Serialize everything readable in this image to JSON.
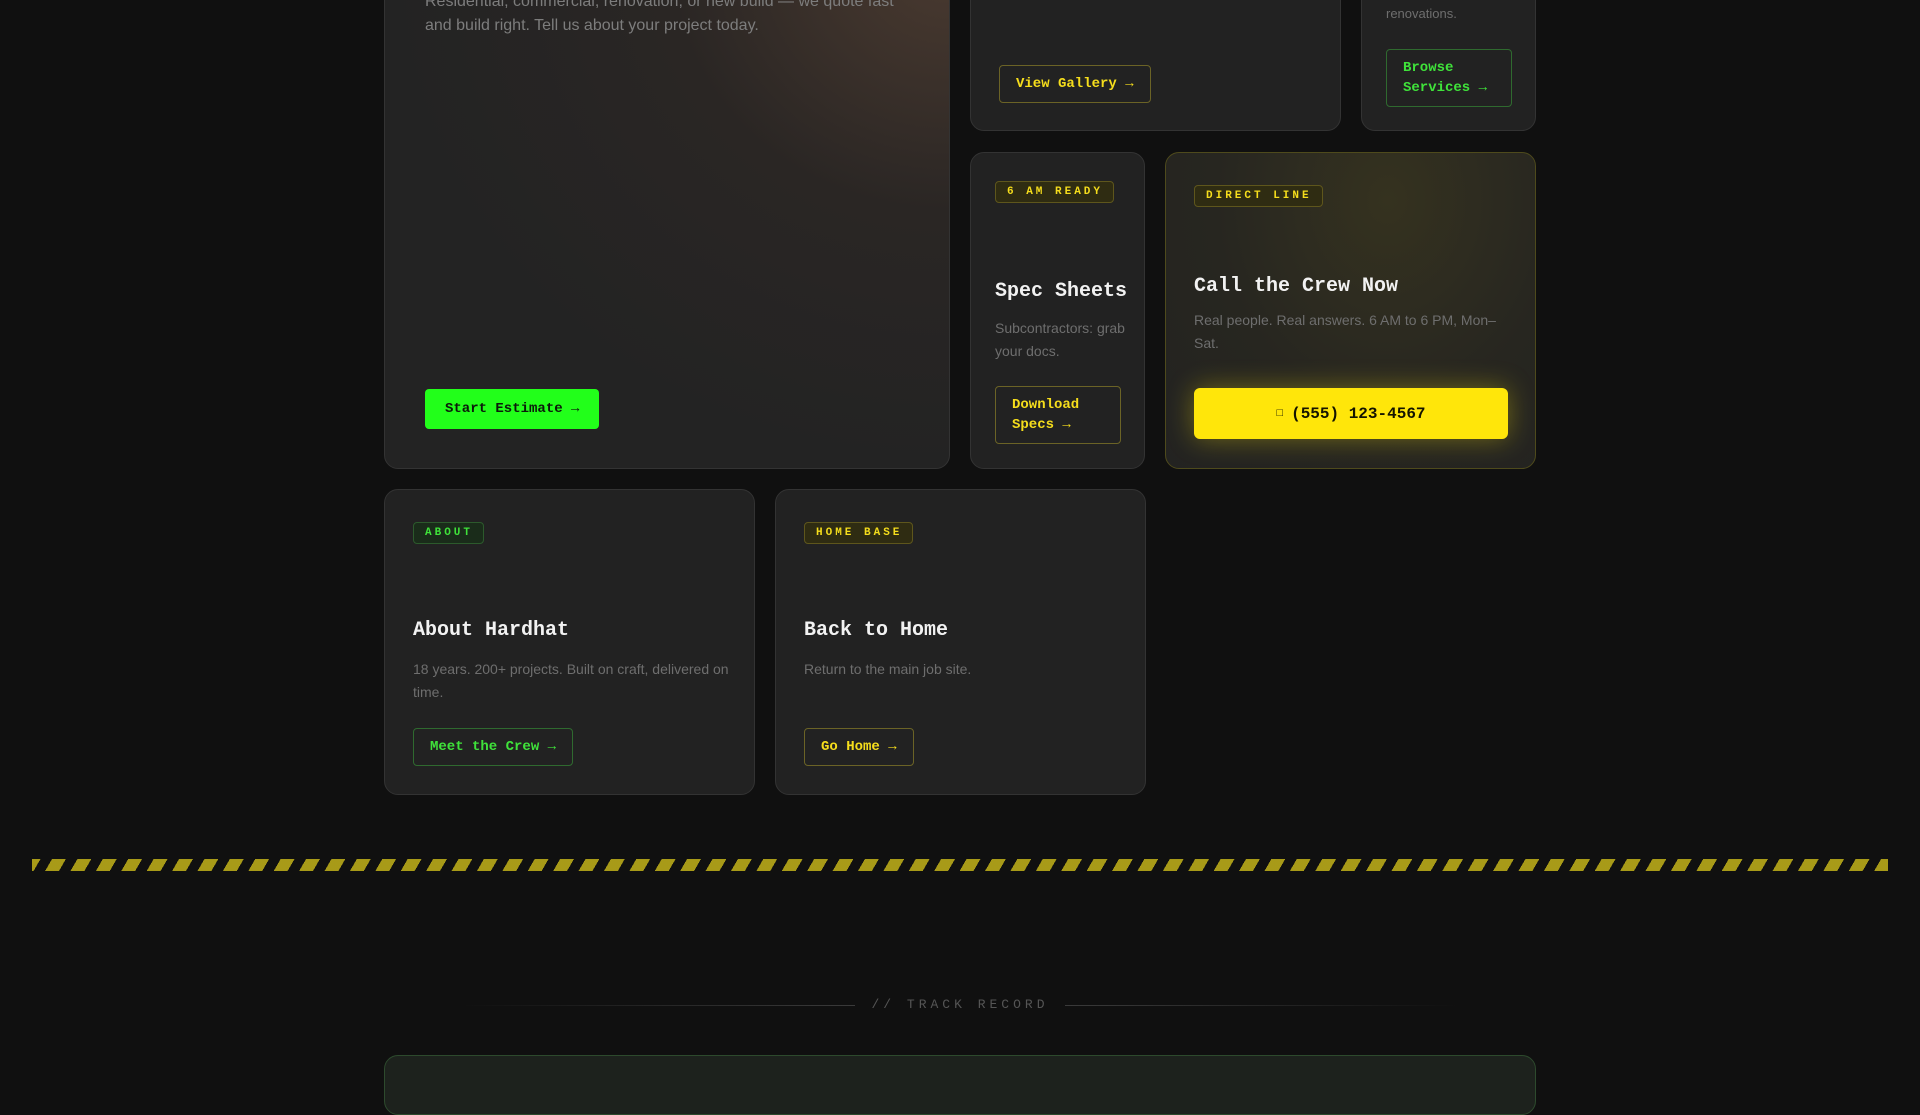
{
  "hero": {
    "description": "Residential, commercial, renovation, or new build — we quote fast and build right. Tell us about your project today.",
    "button": "Start Estimate →"
  },
  "gallery": {
    "button": "View Gallery →"
  },
  "services": {
    "description_fragment": "renovations.",
    "button": "Browse Services →"
  },
  "spec": {
    "tag": "6 AM READY",
    "title": "Spec Sheets",
    "description": "Subcontractors: grab your docs.",
    "button": "Download Specs →"
  },
  "call": {
    "tag": "DIRECT LINE",
    "title": "Call the Crew Now",
    "description": "Real people. Real answers. 6 AM to 6 PM, Mon–Sat.",
    "phone_icon": "□",
    "phone": "(555) 123-4567"
  },
  "about": {
    "tag": "ABOUT",
    "title": "About Hardhat",
    "description": "18 years. 200+ projects. Built on craft, delivered on time.",
    "button": "Meet the Crew →"
  },
  "home": {
    "tag": "HOME BASE",
    "title": "Back to Home",
    "description": "Return to the main job site.",
    "button": "Go Home →"
  },
  "section": {
    "label": "// TRACK RECORD"
  },
  "colors": {
    "accent_green": "#22ff1a",
    "accent_yellow": "#ffe60a",
    "background": "#101010",
    "card": "#222222"
  }
}
